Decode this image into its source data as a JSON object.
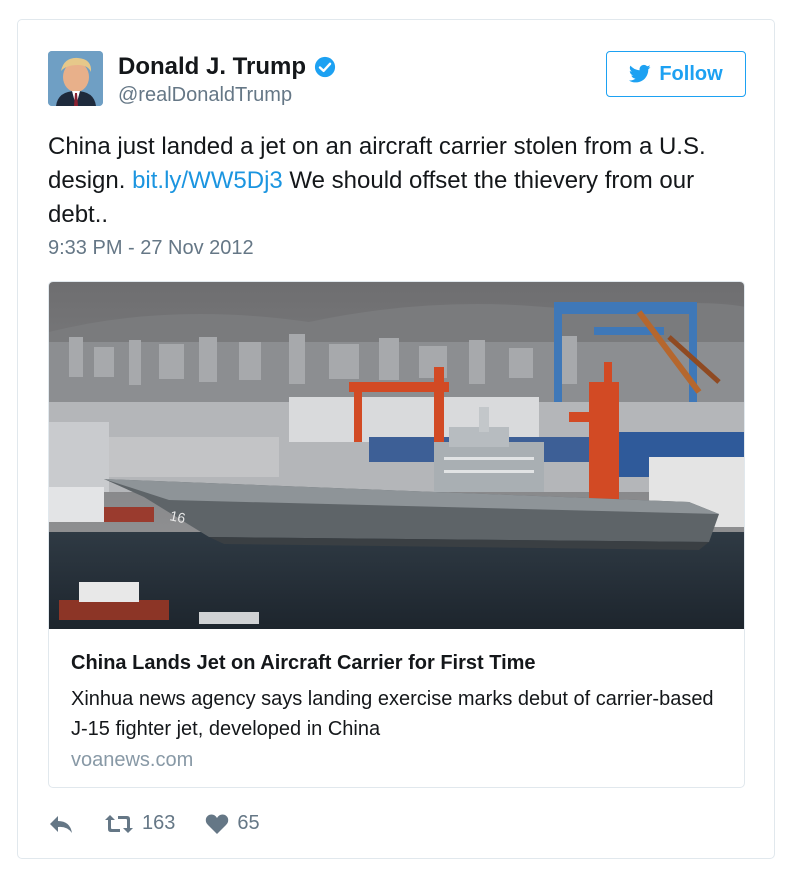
{
  "author": {
    "display_name": "Donald J. Trump",
    "handle": "@realDonaldTrump",
    "verified": true
  },
  "follow_button": {
    "label": "Follow"
  },
  "tweet": {
    "text_before_link": "China just landed a jet on an aircraft carrier stolen from a U.S. design. ",
    "link_text": "bit.ly/WW5Dj3",
    "text_after_link": " We should offset the thievery from our debt..",
    "timestamp": "9:33 PM - 27 Nov 2012"
  },
  "link_card": {
    "title": "China Lands Jet on Aircraft Carrier for First Time",
    "description": "Xinhua news agency says landing exercise marks debut of carrier-based J-15 fighter jet, developed in China",
    "domain": "voanews.com",
    "image_subject": "aircraft-carrier-in-shipyard"
  },
  "actions": {
    "retweet_count": "163",
    "like_count": "65"
  },
  "colors": {
    "accent": "#1da1f2",
    "link": "#1b95e0",
    "text": "#14171a",
    "muted": "#657786",
    "border": "#e1e8ed"
  }
}
